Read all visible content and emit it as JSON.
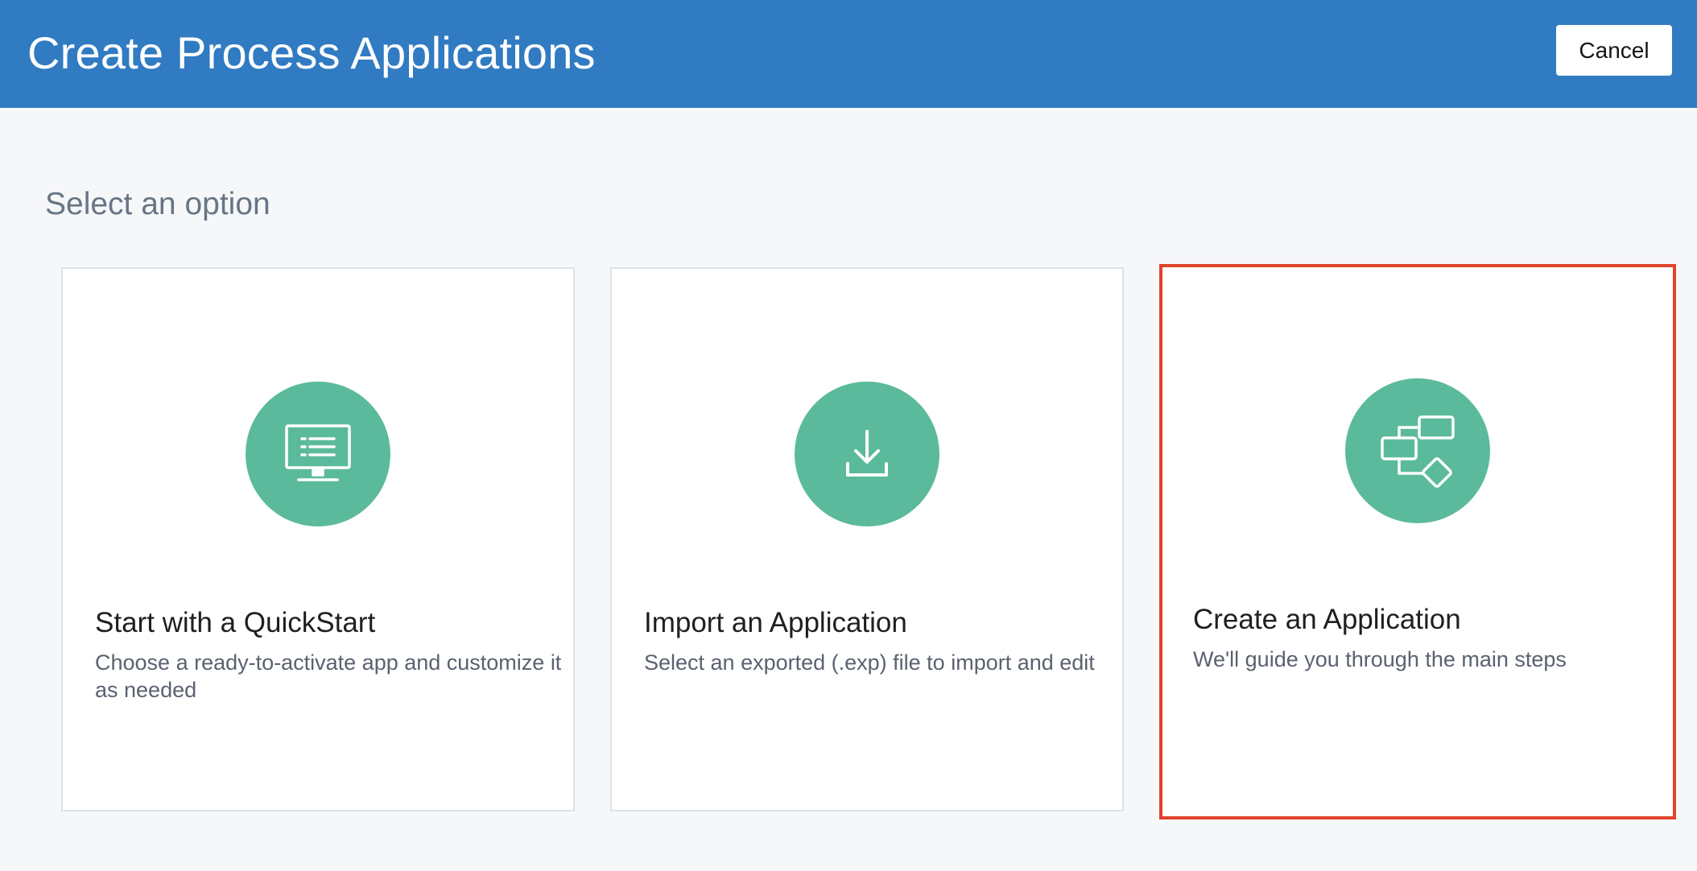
{
  "header": {
    "title": "Create Process Applications",
    "cancel_label": "Cancel"
  },
  "section": {
    "heading": "Select an option"
  },
  "options": [
    {
      "title": "Start with a QuickStart",
      "description": "Choose a ready-to-activate app and customize it as needed",
      "icon": "monitor-icon"
    },
    {
      "title": "Import an Application",
      "description": "Select an exported (.exp) file to import and edit",
      "icon": "download-icon"
    },
    {
      "title": "Create an Application",
      "description": "We'll guide you through the main steps",
      "icon": "flowchart-icon",
      "selected": true
    }
  ],
  "colors": {
    "header_bg": "#307bc2",
    "icon_circle": "#5bba9c",
    "selection_border": "#e0432c",
    "page_bg": "#f6f7f9"
  }
}
